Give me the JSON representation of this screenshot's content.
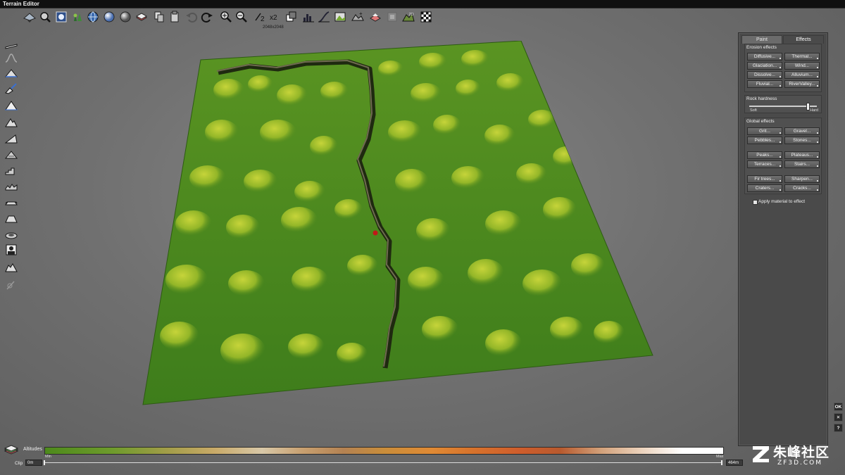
{
  "window": {
    "title": "Terrain Editor"
  },
  "toolbar": {
    "resolution_label": "2048x2048",
    "buttons": [
      {
        "icon": "terrain-view-icon"
      },
      {
        "icon": "zoom-fit-icon"
      },
      {
        "icon": "texture-icon"
      },
      {
        "icon": "plants-icon"
      },
      {
        "icon": "globe-wire-icon"
      },
      {
        "icon": "sphere-icon"
      },
      {
        "icon": "rock-sphere-icon"
      },
      {
        "icon": "layer-icon"
      },
      {
        "icon": "copy-icon"
      },
      {
        "icon": "paste-icon"
      },
      {
        "icon": "undo-icon"
      },
      {
        "icon": "redo-icon"
      },
      {
        "icon": "zoom-in-icon"
      },
      {
        "icon": "zoom-out-icon"
      },
      {
        "icon": "half-resolution-icon",
        "label": "2"
      },
      {
        "icon": "double-resolution-icon",
        "label": "x2"
      },
      {
        "icon": "crop-icon"
      },
      {
        "icon": "histogram-icon"
      },
      {
        "icon": "curve-icon"
      },
      {
        "icon": "terrain-add-icon"
      },
      {
        "icon": "terrain-settings-icon"
      },
      {
        "icon": "flatten-icon"
      },
      {
        "icon": "select-icon"
      },
      {
        "icon": "view-2d-icon",
        "label": "2D"
      },
      {
        "icon": "checker-icon"
      }
    ]
  },
  "left_tools": [
    {
      "icon": "flat-brush-icon"
    },
    {
      "icon": "smooth-brush-icon"
    },
    {
      "icon": "raise-brush-icon"
    },
    {
      "icon": "paint-brush-icon"
    },
    {
      "icon": "peak-brush-icon"
    },
    {
      "icon": "mountain-brush-icon"
    },
    {
      "icon": "slope-brush-icon"
    },
    {
      "icon": "erode-brush-icon"
    },
    {
      "icon": "terrace-brush-icon"
    },
    {
      "icon": "noise-brush-icon"
    },
    {
      "icon": "ripple-brush-icon"
    },
    {
      "icon": "plateau-brush-icon"
    },
    {
      "icon": "crater-brush-icon"
    },
    {
      "icon": "stamp-brush-icon"
    },
    {
      "icon": "rock-brush-icon"
    },
    {
      "icon": "disabled-brush-icon"
    }
  ],
  "panel": {
    "tabs": [
      {
        "label": "Paint"
      },
      {
        "label": "Effects"
      }
    ],
    "erosion": {
      "title": "Erosion effects",
      "buttons": [
        "Diffusive...",
        "Thermal...",
        "Glaciation...",
        "Wind...",
        "Dissolve...",
        "Alluvium...",
        "Fluvial...",
        "RiverValley..."
      ]
    },
    "rock": {
      "title": "Rock hardness",
      "soft": "Soft",
      "hard": "Hard",
      "value": 0.86
    },
    "global": {
      "title": "Global effects",
      "buttons": [
        "Grit...",
        "Gravel...",
        "Pebbles...",
        "Stones...",
        "Peaks...",
        "Plateaus...",
        "Terraces...",
        "Stairs...",
        "Fir trees...",
        "Sharpen...",
        "Craters...",
        "Cracks..."
      ]
    },
    "apply_material": "Apply material to effect"
  },
  "side_buttons": [
    {
      "label": "OK"
    },
    {
      "label": "✕"
    },
    {
      "label": "?"
    }
  ],
  "altitudes": {
    "label": "Altitudes",
    "min": "Min",
    "max": "Max"
  },
  "clip": {
    "label": "Clip",
    "min_value": "0m",
    "max_value": "464m"
  },
  "watermark": {
    "text": "朱峰社区",
    "sub": "ZF3D.COM"
  },
  "colors": {
    "terrain_light": "#a4c22c",
    "terrain_dark": "#3d7a1a",
    "panel": "#4a4a4a"
  }
}
